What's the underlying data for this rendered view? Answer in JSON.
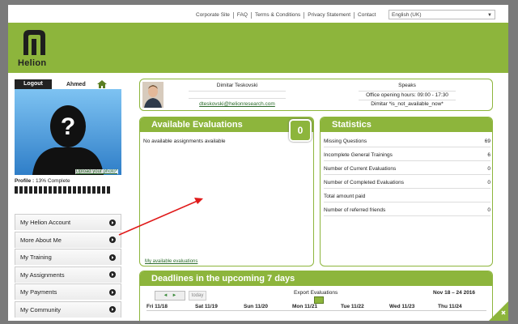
{
  "topnav": {
    "links": [
      "Corporate Site",
      "FAQ",
      "Terms & Conditions",
      "Privacy Statement",
      "Contact"
    ],
    "language": "English (UK)"
  },
  "brand": {
    "name": "Helion",
    "color": "#8db53c"
  },
  "sidebar": {
    "logout": "Logout",
    "username": "Ahmed",
    "upload_photo": "Upload your photo*",
    "profile_label": "Profile :",
    "profile_complete": "13% Complete",
    "profile_fraction": 0.13,
    "menu": [
      {
        "label": "My Helion Account",
        "icon": "chevron-right-icon"
      },
      {
        "label": "More About Me",
        "icon": "chevron-right-icon"
      },
      {
        "label": "My Training",
        "icon": "chevron-right-icon"
      },
      {
        "label": "My Assignments",
        "icon": "chevron-right-icon"
      },
      {
        "label": "My Payments",
        "icon": "chevron-right-icon"
      },
      {
        "label": "My Community",
        "icon": "chevron-right-icon"
      }
    ]
  },
  "usercard": {
    "name": "Dimitar Teskovski",
    "email": "dteskovski@helionresearch.com",
    "speaks_label": "Speaks",
    "office_hours": "Office opening hours: 09:00 - 17:30",
    "language_text": "Dimitar *is_not_available_now*"
  },
  "evaluations": {
    "title": "Available Evaluations",
    "count": "0",
    "empty_text": "No available assignments available",
    "link": "My available evaluations"
  },
  "statistics": {
    "title": "Statistics",
    "rows": [
      {
        "label": "Missing Questions",
        "value": "69"
      },
      {
        "label": "Incomplete General Trainings",
        "value": "6"
      },
      {
        "label": "Number of Current Evaluations",
        "value": "0"
      },
      {
        "label": "Number of Completed Evaluations",
        "value": "0"
      },
      {
        "label": "Total amount paid",
        "value": ""
      },
      {
        "label": "Number of referred friends",
        "value": "0"
      }
    ]
  },
  "deadlines": {
    "title": "Deadlines in the upcoming 7 days",
    "today": "today",
    "export": "Export Evaluations",
    "range": "Nov 18 – 24 2016",
    "days": [
      "Fri 11/18",
      "Sat 11/19",
      "Sun 11/20",
      "Mon 11/21",
      "Tue 11/22",
      "Wed 11/23",
      "Thu 11/24"
    ]
  }
}
